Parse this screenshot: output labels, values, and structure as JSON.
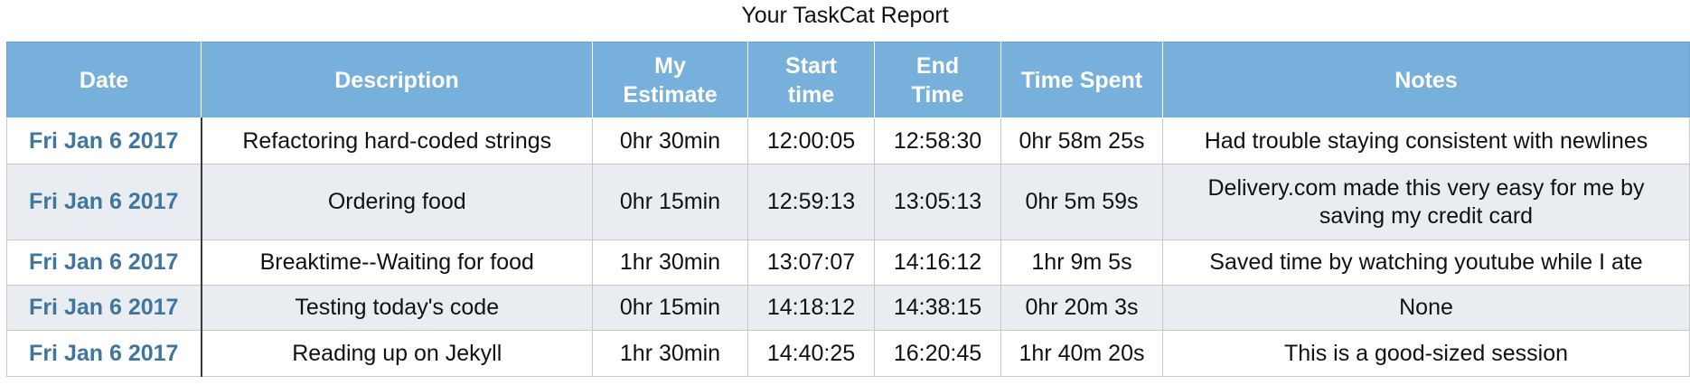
{
  "title": "Your TaskCat Report",
  "headers": {
    "date": "Date",
    "description": "Description",
    "estimate_line1": "My",
    "estimate_line2": "Estimate",
    "start_line1": "Start",
    "start_line2": "time",
    "end_line1": "End",
    "end_line2": "Time",
    "spent": "Time Spent",
    "notes": "Notes"
  },
  "colors": {
    "header_background": "#78b0dc",
    "date_text": "#3f76a0",
    "stripe_background": "#e9edf1"
  },
  "rows": [
    {
      "date": "Fri Jan 6 2017",
      "description": "Refactoring hard-coded strings",
      "estimate": "0hr 30min",
      "start": "12:00:05",
      "end": "12:58:30",
      "spent": "0hr 58m 25s",
      "notes": "Had trouble staying consistent with newlines"
    },
    {
      "date": "Fri Jan 6 2017",
      "description": "Ordering food",
      "estimate": "0hr 15min",
      "start": "12:59:13",
      "end": "13:05:13",
      "spent": "0hr 5m 59s",
      "notes_line1": "Delivery.com made this very easy for me by",
      "notes_line2": "saving my credit card"
    },
    {
      "date": "Fri Jan 6 2017",
      "description": "Breaktime--Waiting for food",
      "estimate": "1hr 30min",
      "start": "13:07:07",
      "end": "14:16:12",
      "spent": "1hr 9m 5s",
      "notes": "Saved time by watching youtube while I ate"
    },
    {
      "date": "Fri Jan 6 2017",
      "description": "Testing today's code",
      "estimate": "0hr 15min",
      "start": "14:18:12",
      "end": "14:38:15",
      "spent": "0hr 20m 3s",
      "notes": "None"
    },
    {
      "date": "Fri Jan 6 2017",
      "description": "Reading up on Jekyll",
      "estimate": "1hr 30min",
      "start": "14:40:25",
      "end": "16:20:45",
      "spent": "1hr 40m 20s",
      "notes": "This is a good-sized session"
    }
  ]
}
